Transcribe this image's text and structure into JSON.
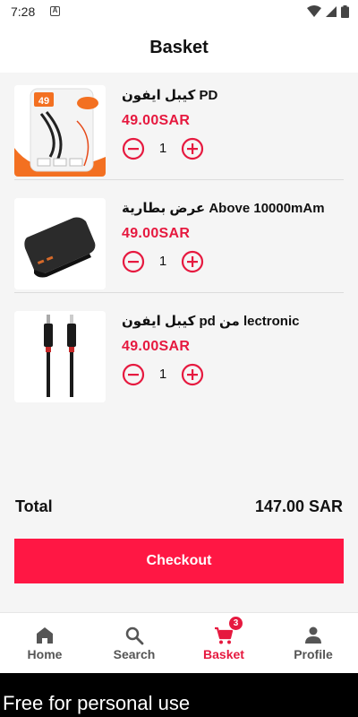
{
  "status_bar": {
    "time": "7:28",
    "notification_glyph": "A"
  },
  "header": {
    "title": "Basket"
  },
  "cart": {
    "items": [
      {
        "title": "كيبل ايفون PD",
        "price": "49.00SAR",
        "quantity": "1",
        "thumb_icon": "usb-c-cable-packaged-image",
        "thumb_badge": "49"
      },
      {
        "title": "عرض بطارية Above 10000mAm",
        "price": "49.00SAR",
        "quantity": "1",
        "thumb_icon": "power-bank-image"
      },
      {
        "title": "كيبل ايفون pd من lectronic",
        "price": "49.00SAR",
        "quantity": "1",
        "thumb_icon": "lightning-cable-image"
      }
    ]
  },
  "total": {
    "label": "Total",
    "value": "147.00 SAR"
  },
  "checkout": {
    "label": "Checkout"
  },
  "nav": {
    "items": [
      {
        "label": "Home",
        "icon": "home-icon"
      },
      {
        "label": "Search",
        "icon": "search-icon"
      },
      {
        "label": "Basket",
        "icon": "cart-icon",
        "badge": "3",
        "active": true
      },
      {
        "label": "Profile",
        "icon": "person-icon"
      }
    ]
  },
  "colors": {
    "accent": "#e6193f",
    "checkout": "#ff1744",
    "background": "#f5f5f5"
  },
  "watermark": "Free for personal use"
}
